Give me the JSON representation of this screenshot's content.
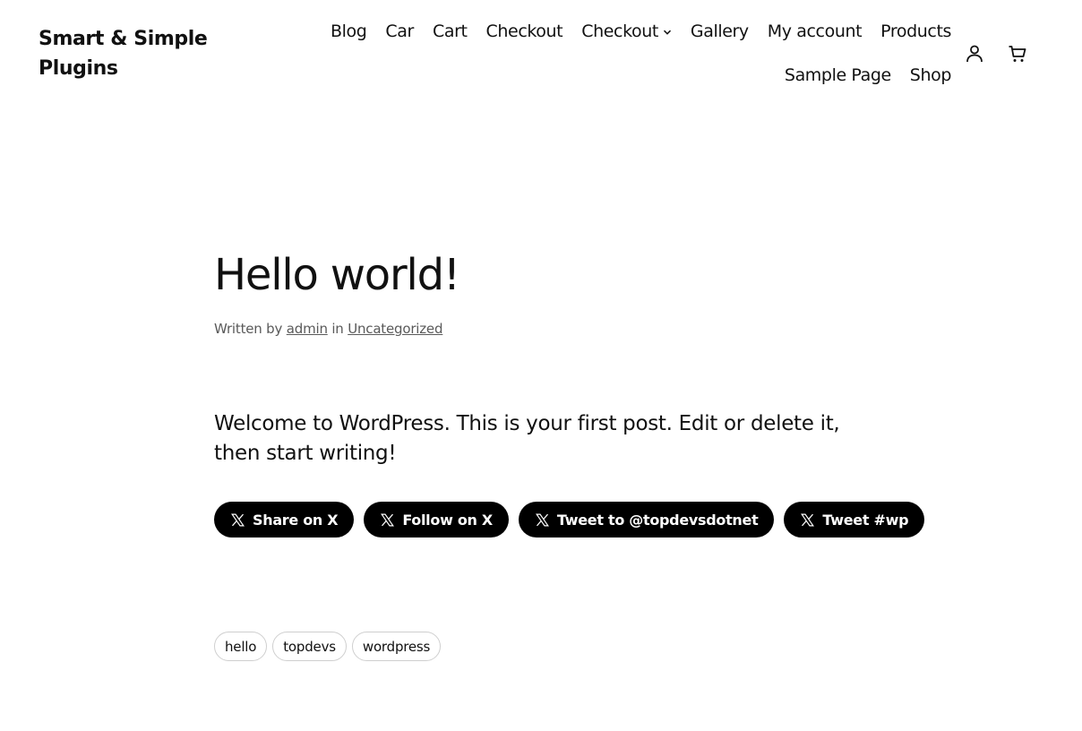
{
  "site": {
    "title": "Smart & Simple Plugins"
  },
  "nav": {
    "items": [
      {
        "label": "Blog"
      },
      {
        "label": "Car"
      },
      {
        "label": "Cart"
      },
      {
        "label": "Checkout"
      },
      {
        "label": "Checkout",
        "has_submenu": true
      },
      {
        "label": "Gallery"
      },
      {
        "label": "My account"
      },
      {
        "label": "Products"
      },
      {
        "label": "Sample Page"
      },
      {
        "label": "Shop"
      }
    ],
    "icons": [
      "account-icon",
      "cart-icon"
    ]
  },
  "post": {
    "title": "Hello world!",
    "meta": {
      "written_by": "Written by",
      "author": "admin",
      "in": "in",
      "category": "Uncategorized"
    },
    "content": "Welcome to WordPress. This is your first post. Edit or delete it, then start writing!"
  },
  "share_buttons": [
    {
      "label": "Share on X",
      "icon": "x-logo-icon"
    },
    {
      "label": "Follow on X",
      "icon": "x-logo-icon"
    },
    {
      "label": "Tweet to @topdevsdotnet",
      "icon": "x-logo-icon"
    },
    {
      "label": "Tweet #wp",
      "icon": "x-logo-icon"
    }
  ],
  "tags": [
    {
      "label": "hello"
    },
    {
      "label": "topdevs"
    },
    {
      "label": "wordpress"
    }
  ],
  "colors": {
    "background": "#ffffff",
    "text": "#111111",
    "meta_text": "#5a5a5a",
    "button_bg": "#000000",
    "button_text": "#ffffff",
    "tag_border": "#cfcfcf"
  }
}
